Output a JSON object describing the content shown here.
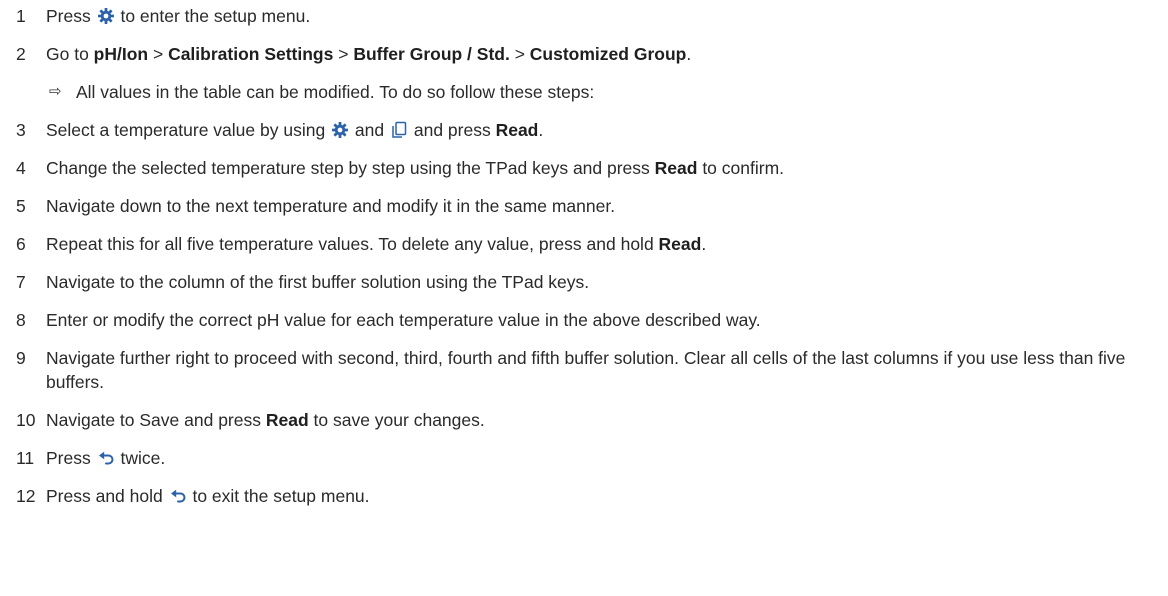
{
  "steps": [
    {
      "num": "1",
      "t1": "Press ",
      "icon": "gear-icon",
      "t2": " to enter the setup menu."
    },
    {
      "num": "2",
      "t1": "Go to ",
      "b1": "pH/Ion",
      "s1": " > ",
      "b2": "Calibration Settings",
      "s2": " > ",
      "b3": "Buffer Group / Std.",
      "s3": " > ",
      "b4": "Customized Group",
      "end": "."
    },
    {
      "result": "All values in the table can be modified. To do so follow these steps:"
    },
    {
      "num": "3",
      "t1": "Select a temperature value by using ",
      "icon1": "gear-icon",
      "t2": " and ",
      "icon2": "copy-icon",
      "t3": " and press ",
      "b": "Read",
      "end": "."
    },
    {
      "num": "4",
      "t1": "Change the selected temperature step by step using the TPad keys and press ",
      "b": "Read",
      "t2": " to confirm."
    },
    {
      "num": "5",
      "t1": "Navigate down to the next temperature and modify it in the same manner."
    },
    {
      "num": "6",
      "t1": "Repeat this for all five temperature values. To delete any value, press and hold ",
      "b": "Read",
      "end": "."
    },
    {
      "num": "7",
      "t1": "Navigate to the column of the first buffer solution using the TPad keys."
    },
    {
      "num": "8",
      "t1": "Enter or modify the correct pH value for each temperature value in the above described way."
    },
    {
      "num": "9",
      "t1": "Navigate further right to proceed with second, third, fourth and fifth buffer solution. Clear all cells of the last columns if you use less than five buffers."
    },
    {
      "num": "10",
      "t1": "Navigate to Save and press ",
      "b": "Read",
      "t2": " to save your changes."
    },
    {
      "num": "11",
      "t1": "Press ",
      "icon": "back-arrow-icon",
      "t2": " twice."
    },
    {
      "num": "12",
      "t1": "Press and hold ",
      "icon": "back-arrow-icon",
      "t2": " to exit the setup menu."
    }
  ],
  "result_arrow": "⇨",
  "colors": {
    "icon_blue": "#2b62a8",
    "text": "#2a2a2a"
  }
}
